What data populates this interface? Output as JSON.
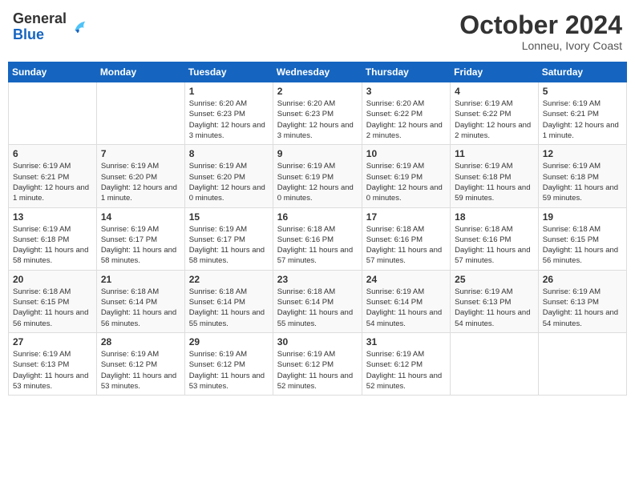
{
  "header": {
    "logo": {
      "general": "General",
      "blue": "Blue"
    },
    "title": "October 2024",
    "location": "Lonneu, Ivory Coast"
  },
  "calendar": {
    "weekdays": [
      "Sunday",
      "Monday",
      "Tuesday",
      "Wednesday",
      "Thursday",
      "Friday",
      "Saturday"
    ],
    "weeks": [
      [
        {
          "day": "",
          "info": ""
        },
        {
          "day": "",
          "info": ""
        },
        {
          "day": "1",
          "info": "Sunrise: 6:20 AM\nSunset: 6:23 PM\nDaylight: 12 hours and 3 minutes."
        },
        {
          "day": "2",
          "info": "Sunrise: 6:20 AM\nSunset: 6:23 PM\nDaylight: 12 hours and 3 minutes."
        },
        {
          "day": "3",
          "info": "Sunrise: 6:20 AM\nSunset: 6:22 PM\nDaylight: 12 hours and 2 minutes."
        },
        {
          "day": "4",
          "info": "Sunrise: 6:19 AM\nSunset: 6:22 PM\nDaylight: 12 hours and 2 minutes."
        },
        {
          "day": "5",
          "info": "Sunrise: 6:19 AM\nSunset: 6:21 PM\nDaylight: 12 hours and 1 minute."
        }
      ],
      [
        {
          "day": "6",
          "info": "Sunrise: 6:19 AM\nSunset: 6:21 PM\nDaylight: 12 hours and 1 minute."
        },
        {
          "day": "7",
          "info": "Sunrise: 6:19 AM\nSunset: 6:20 PM\nDaylight: 12 hours and 1 minute."
        },
        {
          "day": "8",
          "info": "Sunrise: 6:19 AM\nSunset: 6:20 PM\nDaylight: 12 hours and 0 minutes."
        },
        {
          "day": "9",
          "info": "Sunrise: 6:19 AM\nSunset: 6:19 PM\nDaylight: 12 hours and 0 minutes."
        },
        {
          "day": "10",
          "info": "Sunrise: 6:19 AM\nSunset: 6:19 PM\nDaylight: 12 hours and 0 minutes."
        },
        {
          "day": "11",
          "info": "Sunrise: 6:19 AM\nSunset: 6:18 PM\nDaylight: 11 hours and 59 minutes."
        },
        {
          "day": "12",
          "info": "Sunrise: 6:19 AM\nSunset: 6:18 PM\nDaylight: 11 hours and 59 minutes."
        }
      ],
      [
        {
          "day": "13",
          "info": "Sunrise: 6:19 AM\nSunset: 6:18 PM\nDaylight: 11 hours and 58 minutes."
        },
        {
          "day": "14",
          "info": "Sunrise: 6:19 AM\nSunset: 6:17 PM\nDaylight: 11 hours and 58 minutes."
        },
        {
          "day": "15",
          "info": "Sunrise: 6:19 AM\nSunset: 6:17 PM\nDaylight: 11 hours and 58 minutes."
        },
        {
          "day": "16",
          "info": "Sunrise: 6:18 AM\nSunset: 6:16 PM\nDaylight: 11 hours and 57 minutes."
        },
        {
          "day": "17",
          "info": "Sunrise: 6:18 AM\nSunset: 6:16 PM\nDaylight: 11 hours and 57 minutes."
        },
        {
          "day": "18",
          "info": "Sunrise: 6:18 AM\nSunset: 6:16 PM\nDaylight: 11 hours and 57 minutes."
        },
        {
          "day": "19",
          "info": "Sunrise: 6:18 AM\nSunset: 6:15 PM\nDaylight: 11 hours and 56 minutes."
        }
      ],
      [
        {
          "day": "20",
          "info": "Sunrise: 6:18 AM\nSunset: 6:15 PM\nDaylight: 11 hours and 56 minutes."
        },
        {
          "day": "21",
          "info": "Sunrise: 6:18 AM\nSunset: 6:14 PM\nDaylight: 11 hours and 56 minutes."
        },
        {
          "day": "22",
          "info": "Sunrise: 6:18 AM\nSunset: 6:14 PM\nDaylight: 11 hours and 55 minutes."
        },
        {
          "day": "23",
          "info": "Sunrise: 6:18 AM\nSunset: 6:14 PM\nDaylight: 11 hours and 55 minutes."
        },
        {
          "day": "24",
          "info": "Sunrise: 6:19 AM\nSunset: 6:14 PM\nDaylight: 11 hours and 54 minutes."
        },
        {
          "day": "25",
          "info": "Sunrise: 6:19 AM\nSunset: 6:13 PM\nDaylight: 11 hours and 54 minutes."
        },
        {
          "day": "26",
          "info": "Sunrise: 6:19 AM\nSunset: 6:13 PM\nDaylight: 11 hours and 54 minutes."
        }
      ],
      [
        {
          "day": "27",
          "info": "Sunrise: 6:19 AM\nSunset: 6:13 PM\nDaylight: 11 hours and 53 minutes."
        },
        {
          "day": "28",
          "info": "Sunrise: 6:19 AM\nSunset: 6:12 PM\nDaylight: 11 hours and 53 minutes."
        },
        {
          "day": "29",
          "info": "Sunrise: 6:19 AM\nSunset: 6:12 PM\nDaylight: 11 hours and 53 minutes."
        },
        {
          "day": "30",
          "info": "Sunrise: 6:19 AM\nSunset: 6:12 PM\nDaylight: 11 hours and 52 minutes."
        },
        {
          "day": "31",
          "info": "Sunrise: 6:19 AM\nSunset: 6:12 PM\nDaylight: 11 hours and 52 minutes."
        },
        {
          "day": "",
          "info": ""
        },
        {
          "day": "",
          "info": ""
        }
      ]
    ]
  }
}
